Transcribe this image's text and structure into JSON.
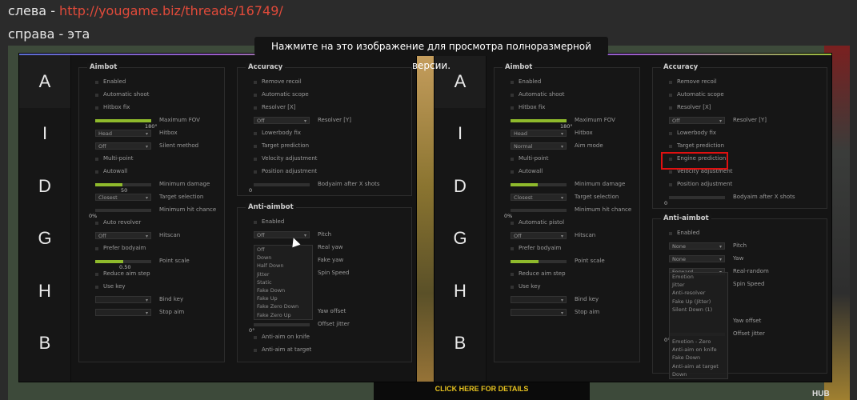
{
  "post": {
    "line1_prefix": "слева - ",
    "line1_link": "http://yougame.biz/threads/16749/",
    "line2": "справа - эта",
    "tooltip": "Нажмите на это изображение для просмотра полноразмерной версии."
  },
  "background": {
    "banner": "CLICK HERE FOR DETAILS"
  },
  "tabs": [
    "A",
    "I",
    "D",
    "G",
    "H",
    "B"
  ],
  "left": {
    "aimbot_title": "Aimbot",
    "accuracy_title": "Accuracy",
    "antiaim_title": "Anti-aimbot",
    "aim": {
      "enabled": "Enabled",
      "automatic_shoot": "Automatic shoot",
      "hitbox_fix": "Hitbox fix",
      "max_fov_label": "Maximum FOV",
      "max_fov_val": "180°",
      "hitbox_combo": "Head",
      "hitbox_label": "Hitbox",
      "silent_combo": "Off",
      "silent_label": "Silent method",
      "multipoint": "Multi-point",
      "autowall": "Autowall",
      "min_dmg_label": "Minimum damage",
      "min_dmg_val": "50",
      "target_sel_combo": "Closest",
      "target_sel_label": "Target selection",
      "min_hit_label": "Minimum hit chance",
      "min_hit_val": "0%",
      "auto_revolver": "Auto revolver",
      "hitscan_combo": "Off",
      "hitscan_label": "Hitscan",
      "prefer_bodyaim": "Prefer bodyaim",
      "point_scale_label": "Point scale",
      "point_scale_val": "0.50",
      "reduce_aim_step": "Reduce aim step",
      "use_key": "Use key",
      "bind_key_label": "Bind key",
      "stop_aim_label": "Stop aim"
    },
    "acc": {
      "remove_recoil": "Remove recoil",
      "automatic_scope": "Automatic scope",
      "resolver_x": "Resolver [X]",
      "resolver_y_combo": "Off",
      "resolver_y_label": "Resolver [Y]",
      "lowerbody_fix": "Lowerbody fix",
      "target_prediction": "Target prediction",
      "velocity_adj": "Velocity adjustment",
      "position_adj": "Position adjustment",
      "bodyaim_label": "Bodyaim after X shots",
      "bodyaim_val": "0"
    },
    "aa": {
      "enabled": "Enabled",
      "pitch_combo": "Off",
      "pitch_label": "Pitch",
      "real_yaw": "Real yaw",
      "fake_yaw": "Fake yaw",
      "spin_speed": "Spin Speed",
      "yaw_offset": "Yaw offset",
      "offset_jitter": "Offset jitter",
      "offset_val": "0°",
      "antiaim_knife": "Anti-aim on knife",
      "antiaim_target": "Anti-aim at target",
      "dropdown": [
        "Off",
        "Down",
        "Half Down",
        "Jitter",
        "Static",
        "Fake Down",
        "Fake Up",
        "Fake Zero Down",
        "Fake Zero Up"
      ]
    }
  },
  "right": {
    "aimbot_title": "Aimbot",
    "accuracy_title": "Accuracy",
    "antiaim_title": "Anti-aimbot",
    "aim": {
      "enabled": "Enabled",
      "automatic_shoot": "Automatic shoot",
      "hitbox_fix": "Hitbox fix",
      "max_fov_label": "Maximum FOV",
      "max_fov_val": "180°",
      "hitbox_combo": "Head",
      "hitbox_label": "Hitbox",
      "aim_mode_combo": "Normal",
      "aim_mode_label": "Aim mode",
      "multipoint": "Multi-point",
      "autowall": "Autowall",
      "min_dmg_label": "Minimum damage",
      "target_sel_combo": "Closest",
      "target_sel_label": "Target selection",
      "min_hit_label": "Minimum hit chance",
      "min_hit_val": "0%",
      "auto_pistol": "Automatic pistol",
      "hitscan_combo": "Off",
      "hitscan_label": "Hitscan",
      "prefer_bodyaim": "Prefer bodyaim",
      "point_scale_label": "Point scale",
      "reduce_aim_step": "Reduce aim step",
      "use_key": "Use key",
      "bind_key_label": "Bind key",
      "stop_aim_label": "Stop aim"
    },
    "acc": {
      "remove_recoil": "Remove recoil",
      "automatic_scope": "Automatic scope",
      "resolver_x": "Resolver [X]",
      "resolver_y_combo": "Off",
      "resolver_y_label": "Resolver [Y]",
      "lowerbody_fix": "Lowerbody fix",
      "target_prediction": "Target prediction",
      "engine_prediction": "Engine prediction",
      "velocity_adj": "Velocity adjustment",
      "position_adj": "Position adjustment",
      "bodyaim_label": "Bodyaim after X shots",
      "bodyaim_val": "0"
    },
    "aa": {
      "enabled": "Enabled",
      "pitch_combo": "None",
      "pitch_label": "Pitch",
      "yaw_combo": "None",
      "yaw_label": "Yaw",
      "real_random_combo": "Forward",
      "real_random_label": "Real-random",
      "spin_speed": "Spin Speed",
      "yaw_offset": "Yaw offset",
      "offset_jitter": "Offset jitter",
      "offset_val": "0°",
      "overlap_lines": [
        "Emotion",
        "Jitter",
        "Anti-resolver",
        "Fake Up (Jitter)",
        "Silent Down (1)",
        "Emotion - Zero",
        "Fake Down",
        "Down"
      ],
      "antiaim_knife": "Anti-aim on knife",
      "antiaim_target": "Anti-aim at target"
    }
  },
  "misc": {
    "hub_text": "HUB"
  }
}
